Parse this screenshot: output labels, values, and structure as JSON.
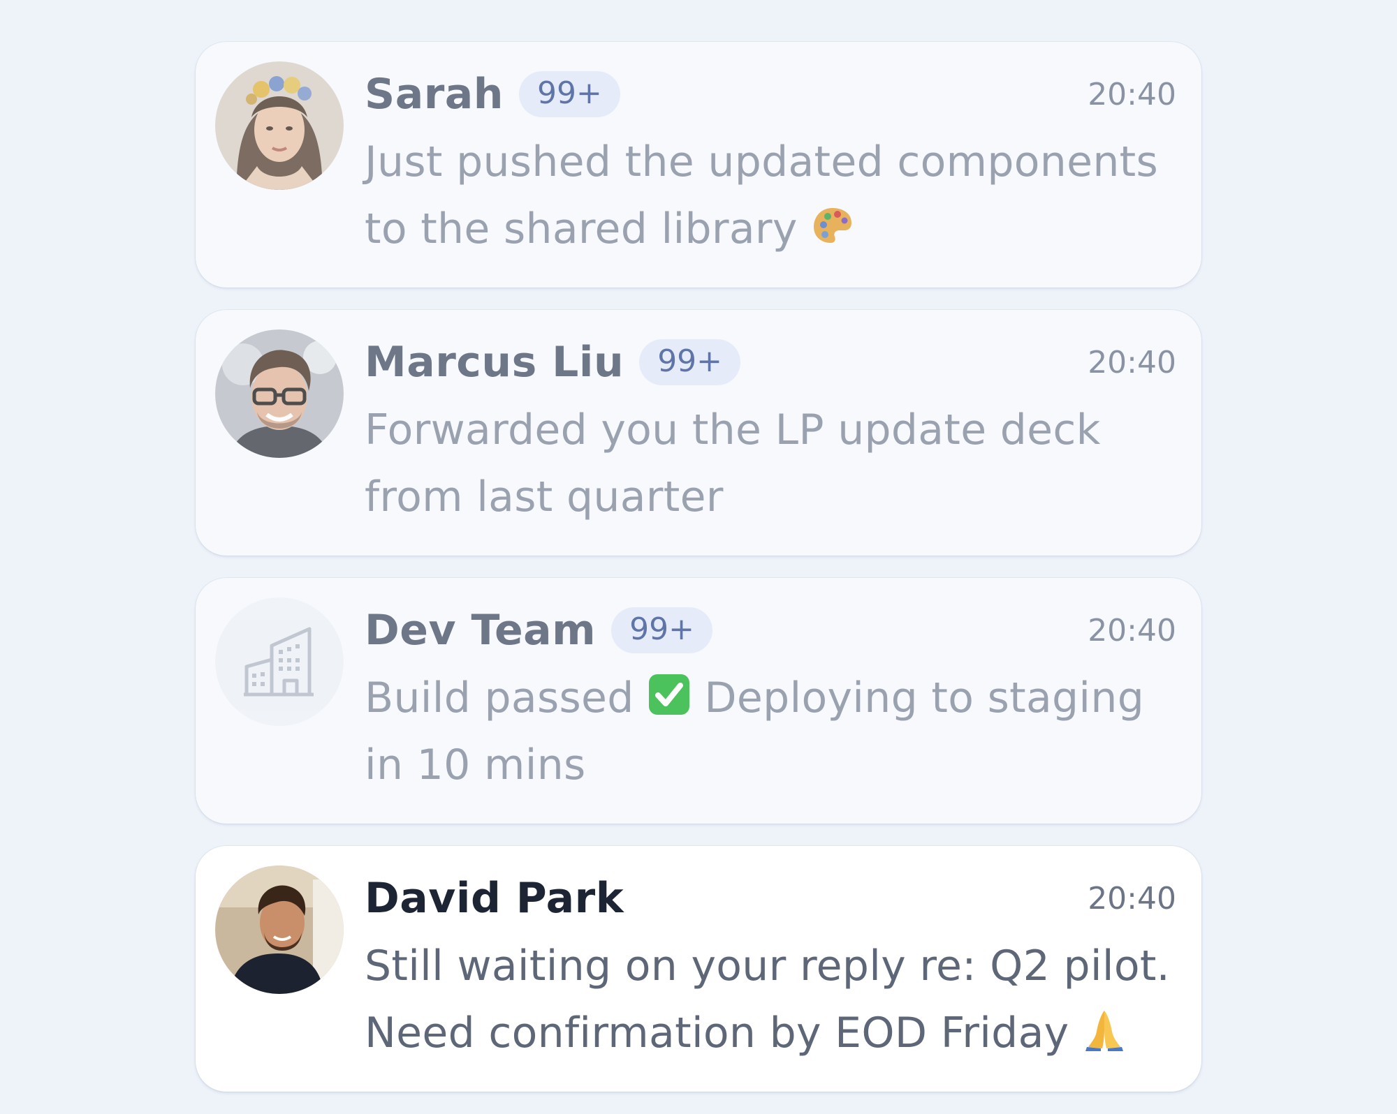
{
  "conversations": [
    {
      "name": "Sarah",
      "badge": "99+",
      "time": "20:40",
      "message": "Just pushed the updated components to the shared library",
      "emoji": "artist-palette",
      "avatar": "photo-woman-flower-crown",
      "read": true
    },
    {
      "name": "Marcus Liu",
      "badge": "99+",
      "time": "20:40",
      "message": "Forwarded you the LP update deck from last quarter",
      "avatar": "photo-man-glasses",
      "read": true
    },
    {
      "name": "Dev Team",
      "badge": "99+",
      "time": "20:40",
      "message_before": "Build passed",
      "emoji": "check-mark-button",
      "message_after": "Deploying to staging in 10 mins",
      "avatar": "building-icon",
      "read": true
    },
    {
      "name": "David Park",
      "badge": "",
      "time": "20:40",
      "message": "Still waiting on your reply re: Q2 pilot. Need confirmation by EOD Friday",
      "emoji": "folded-hands",
      "avatar": "photo-man-beard",
      "read": false
    }
  ],
  "colors": {
    "background": "#eef3fa",
    "badge_bg": "#e5ebf8",
    "badge_text": "#5f75a8",
    "check_green": "#4cc25c"
  }
}
